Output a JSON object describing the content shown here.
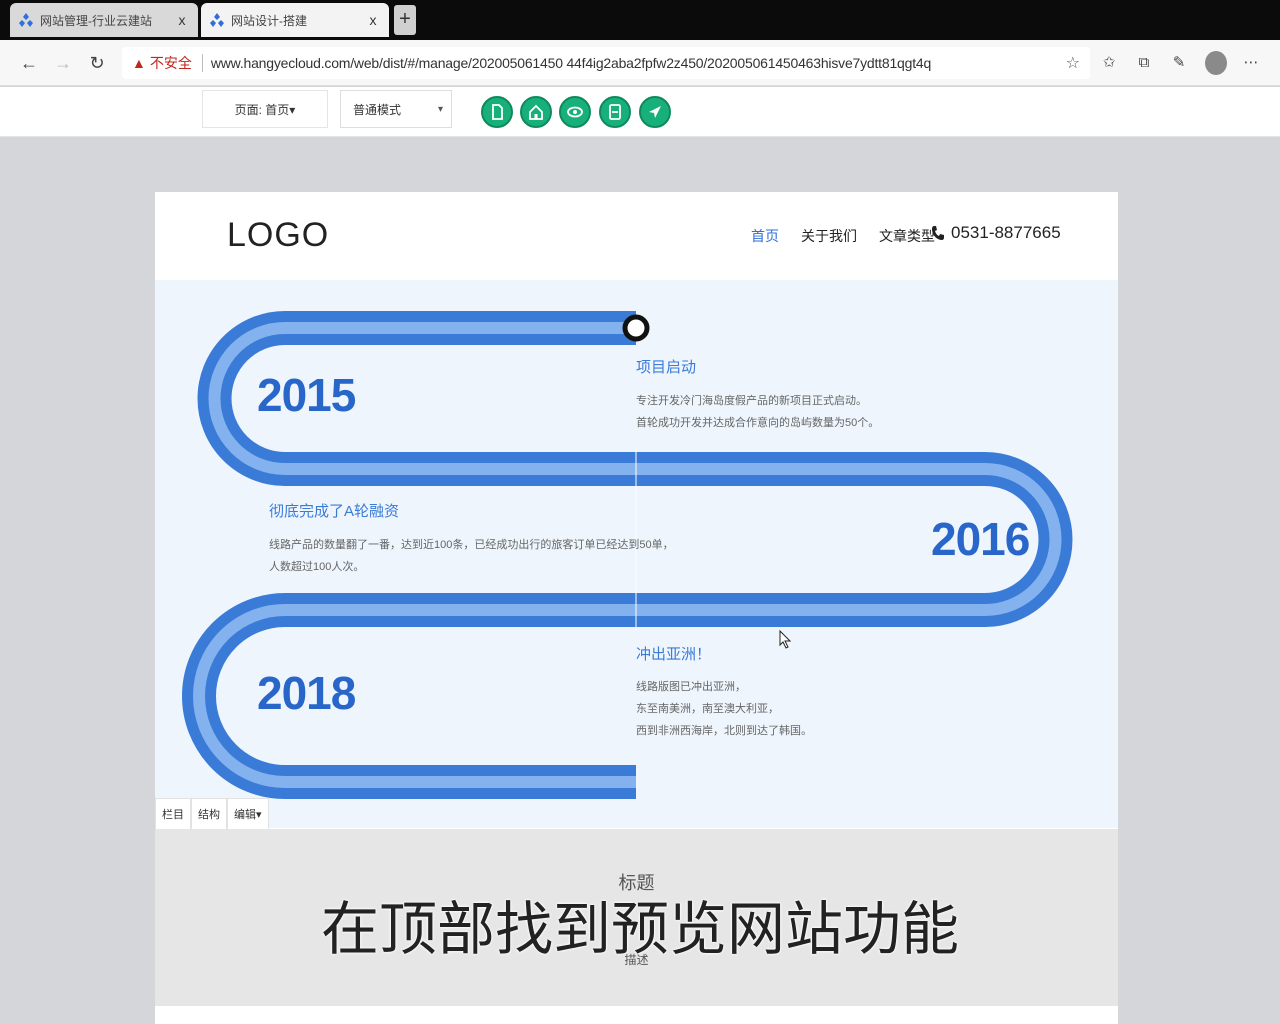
{
  "browser": {
    "tabs": [
      {
        "title": "网站管理-行业云建站",
        "close": "x"
      },
      {
        "title": "网站设计-搭建",
        "close": "x"
      }
    ],
    "new_tab": "+",
    "security_label": "不安全",
    "url": "www.hangyecloud.com/web/dist/#/manage/202005061450 44f4ig2aba2fpfw2z450/202005061450463hisve7ydtt81qgt4q"
  },
  "toolbar": {
    "page_select": "页面: 首页▾",
    "mode_select": "普通模式",
    "buttons": [
      "page-icon",
      "home-icon",
      "eye-icon",
      "save-icon",
      "send-icon"
    ]
  },
  "site": {
    "logo": "LOGO",
    "nav": [
      "首页",
      "关于我们",
      "文章类型"
    ],
    "phone": "0531-8877665"
  },
  "timeline": {
    "events": [
      {
        "year": "2015",
        "title": "项目启动",
        "desc": [
          "专注开发冷门海岛度假产品的新项目正式启动。",
          "首轮成功开发并达成合作意向的岛屿数量为50个。"
        ]
      },
      {
        "year": "2016",
        "title": "彻底完成了A轮融资",
        "desc": [
          "线路产品的数量翻了一番，达到近100条，已经成功出行的旅客订单已经达到50单，",
          "人数超过100人次。"
        ]
      },
      {
        "year": "2018",
        "title": "冲出亚洲！",
        "desc": [
          "线路版图已冲出亚洲，",
          "东至南美洲，南至澳大利亚，",
          "西到非洲西海岸，北则到达了韩国。"
        ]
      }
    ],
    "colors": {
      "outer": "#3a7bd8",
      "inner": "#8db8f2",
      "bg": "#eef5fd"
    }
  },
  "block_tabs": [
    "栏目",
    "结构",
    "编辑▾"
  ],
  "section": {
    "title": "标题",
    "desc": "描述"
  },
  "subtitle": "在顶部找到预览网站功能"
}
